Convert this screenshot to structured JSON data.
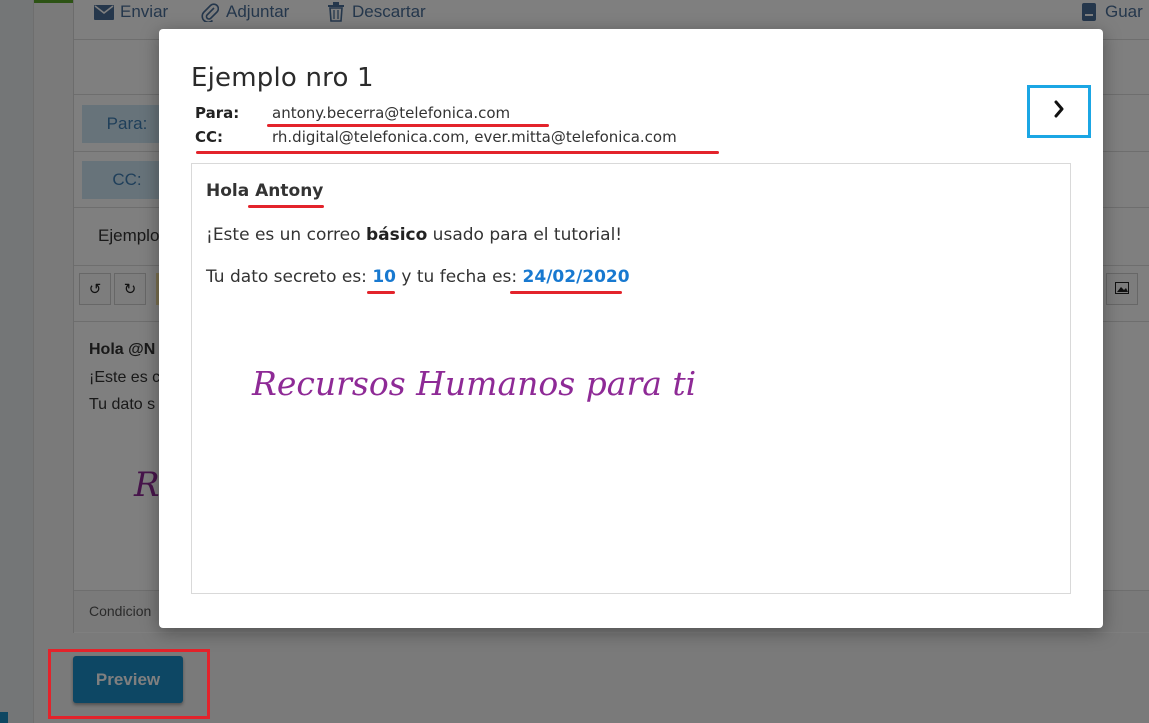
{
  "background": {
    "toolbar": {
      "send": "Enviar",
      "attach": "Adjuntar",
      "discard": "Descartar",
      "save": "Guar"
    },
    "fields": {
      "to_label": "Para:",
      "cc_label": "CC:"
    },
    "subject": "Ejemplo",
    "editor_lines": [
      "Hola @N",
      "¡Este es c",
      "Tu dato s"
    ],
    "signature_fragment": "Re",
    "footer": "Condicion",
    "preview_button": "Preview"
  },
  "modal": {
    "title": "Ejemplo nro 1",
    "to_label": "Para:",
    "to_value": "antony.becerra@telefonica.com",
    "cc_label": "CC:",
    "cc_value": "rh.digital@telefonica.com, ever.mitta@telefonica.com",
    "body": {
      "greeting_prefix": "Hola ",
      "greeting_name": "Antony",
      "line1_prefix": "¡Este es un correo ",
      "line1_bold": "básico",
      "line1_suffix": " usado para el tutorial!",
      "line2_prefix": "Tu dato secreto es: ",
      "secret_value": "10",
      "line2_middle": " y tu fecha es: ",
      "date_value": "24/02/2020",
      "signature": "Recursos Humanos para ti"
    }
  },
  "colors": {
    "accent_blue": "#1a8ec9",
    "highlight_red": "#e3232b",
    "next_border": "#1ba6e4",
    "signature_purple": "#8e2a96"
  }
}
